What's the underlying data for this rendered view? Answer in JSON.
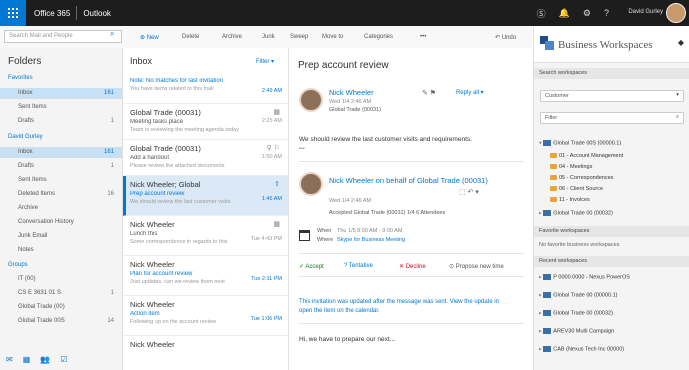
{
  "topbar": {
    "suite": "Office 365",
    "app": "Outlook",
    "user": "David Gurley",
    "icons": [
      "skype-icon",
      "bell-icon",
      "gear-icon",
      "help-icon"
    ]
  },
  "search": {
    "placeholder": "Search Mail and People"
  },
  "commands": {
    "new": "⊕ New",
    "delete": "Delete",
    "archive": "Archive",
    "junk": "Junk",
    "sweep": "Sweep",
    "move": "Move to",
    "categories": "Categories",
    "more": "•••",
    "undo": "↶ Undo"
  },
  "nav": {
    "title": "Folders",
    "favorites": "Favorites",
    "fav_items": [
      {
        "label": "Inbox",
        "count": "161"
      },
      {
        "label": "Sent Items",
        "count": ""
      },
      {
        "label": "Drafts",
        "count": "1"
      }
    ],
    "account": "David Gurley",
    "acc_items": [
      {
        "label": "Inbox",
        "count": "161"
      },
      {
        "label": "Drafts",
        "count": "1"
      },
      {
        "label": "Sent Items",
        "count": ""
      },
      {
        "label": "Deleted Items",
        "count": "16"
      },
      {
        "label": "Archive",
        "count": ""
      },
      {
        "label": "Conversation History",
        "count": ""
      },
      {
        "label": "Junk Email",
        "count": ""
      },
      {
        "label": "Notes",
        "count": ""
      }
    ],
    "groups": "Groups",
    "group_items": [
      {
        "label": "IT (00)",
        "count": ""
      },
      {
        "label": "CS E 3631 01 S",
        "count": "1"
      },
      {
        "label": "Global Trade (00)",
        "count": ""
      },
      {
        "label": "Global Trade 00S",
        "count": "14"
      }
    ]
  },
  "list": {
    "title": "Inbox",
    "filter": "Filter ▾",
    "messages": [
      {
        "from": "",
        "subject": "Note: No matches for last invitation",
        "preview": "You have items related to this mail",
        "time": "2:49 AM"
      },
      {
        "from": "Global Trade (00031)",
        "subject": "Meeting tasks place",
        "preview": "Team is reviewing the meeting agenda today",
        "time": "2:25 AM"
      },
      {
        "from": "Global Trade (00031)",
        "subject": "Add a handout",
        "preview": "Please review the attached documents",
        "time": "1:50 AM"
      },
      {
        "from": "Nick Wheeler; Global",
        "subject": "Prep account review",
        "preview": "We should review the last customer visits",
        "time": "1:46 AM"
      },
      {
        "from": "Nick Wheeler",
        "subject": "Lunch this",
        "preview": "Some correspondence in regards to this",
        "time": "Tue 4:43 PM"
      },
      {
        "from": "Nick Wheeler",
        "subject": "Plan for account review",
        "preview": "Just updates, can we review them next",
        "time": "Tue 2:11 PM"
      },
      {
        "from": "Nick Wheeler",
        "subject": "Action item",
        "preview": "Following up on the account review",
        "time": "Tue 1:06 PM"
      },
      {
        "from": "Nick Wheeler",
        "subject": "",
        "preview": "",
        "time": ""
      }
    ]
  },
  "reading": {
    "title": "Prep account review",
    "sender": "Nick Wheeler",
    "sent_meta": "Wed 1/4 2:46 AM",
    "to_line": "Global Trade (00031)",
    "reply_all": "Reply all ▾",
    "body1": "We should review the last customer visits and requirements.",
    "body1_more": "•••",
    "sender2": "Nick Wheeler on behalf of Global Trade (00031)",
    "sent2_meta": "Wed 1/4 2:46 AM",
    "accepted_by": "Accepted  Global Trade (00031) 1/4 6 Attendees",
    "when_label": "When",
    "when_value": "Thu 1/5 8:00 AM - 9:00 AM",
    "where_label": "Where",
    "where_value": "Skype for Business Meeting",
    "accept": "✓ Accept",
    "tentative": "? Tentative",
    "decline": "✕ Decline",
    "propose": "⊙ Propose new time",
    "link": "This invitation was updated after the message was sent. View the update in",
    "link2": "open the item on the calendar.",
    "footer": "Hi, we have to prepare our next..."
  },
  "bw": {
    "title": "Business Workspaces",
    "pin": "📌",
    "sec1": "Search workspaces",
    "dd1": "Customer",
    "dd2": "Filter",
    "tree": [
      {
        "label": "Global Trade 00S (00000.1)",
        "kind": "grp",
        "indent": 0
      },
      {
        "label": "01 - Account Management",
        "kind": "fold",
        "indent": 1
      },
      {
        "label": "04 - Meetings",
        "kind": "fold",
        "indent": 1
      },
      {
        "label": "05 - Correspondences",
        "kind": "fold",
        "indent": 1
      },
      {
        "label": "06 - Client Source",
        "kind": "fold",
        "indent": 1
      },
      {
        "label": "11 - Invoices",
        "kind": "fold",
        "indent": 1
      },
      {
        "label": "Global Trade 00 (00032)",
        "kind": "grp",
        "indent": 0
      }
    ],
    "sec2": "Favorite workspaces",
    "fav_text": "No favorite business workspaces",
    "sec3": "Recent workspaces",
    "recent": [
      "P 0000.0000 - Nexus PowerOS",
      "Global Trade 00 (00000.1)",
      "Global Trade 00 (00032)",
      "AREV30 Multi Campaign",
      "CAB (Nexus Tech Inc 00000)"
    ]
  }
}
